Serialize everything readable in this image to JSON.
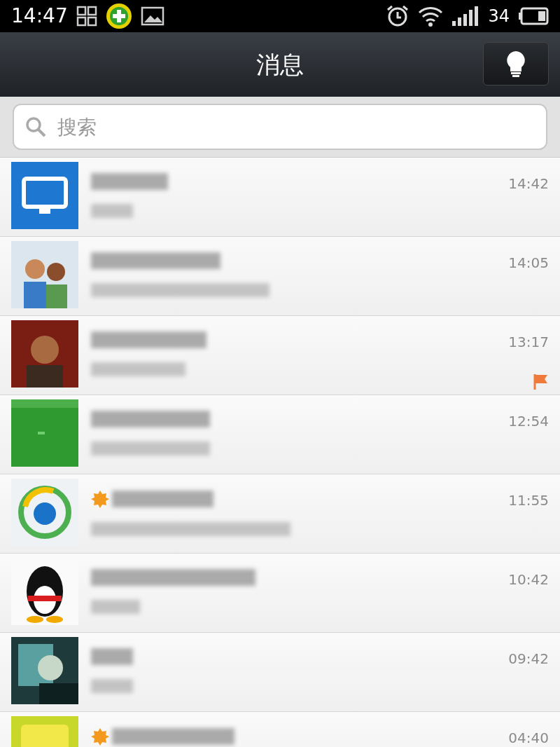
{
  "status_bar": {
    "time": "14:47",
    "battery": "34"
  },
  "header": {
    "title": "消息"
  },
  "search": {
    "placeholder": "搜索"
  },
  "conversations": [
    {
      "time": "14:42",
      "official": false,
      "flagged": false
    },
    {
      "time": "14:05",
      "official": false,
      "flagged": false
    },
    {
      "time": "13:17",
      "official": false,
      "flagged": true
    },
    {
      "time": "12:54",
      "official": false,
      "flagged": false
    },
    {
      "time": "11:55",
      "official": true,
      "flagged": false
    },
    {
      "time": "10:42",
      "official": false,
      "flagged": false
    },
    {
      "time": "09:42",
      "official": false,
      "flagged": false
    },
    {
      "time": "04:40",
      "official": true,
      "flagged": false
    }
  ]
}
